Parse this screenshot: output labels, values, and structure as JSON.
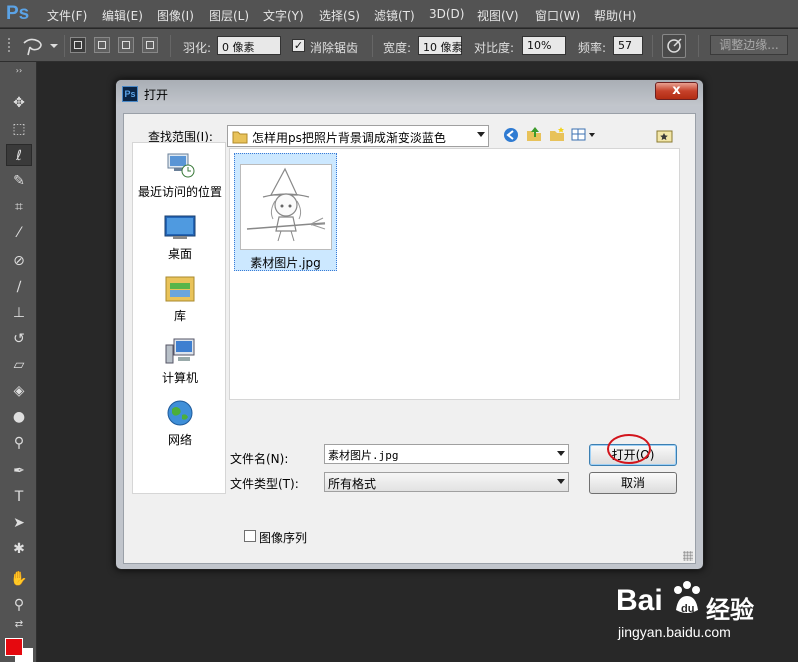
{
  "menubar": {
    "logo": "Ps",
    "items": [
      "文件(F)",
      "编辑(E)",
      "图像(I)",
      "图层(L)",
      "文字(Y)",
      "选择(S)",
      "滤镜(T)",
      "3D(D)",
      "视图(V)",
      "窗口(W)",
      "帮助(H)"
    ]
  },
  "options": {
    "feather_label": "羽化:",
    "feather_value": "0 像素",
    "antialias_label": "消除锯齿",
    "antialias_checked": true,
    "width_label": "宽度:",
    "width_value": "10 像素",
    "contrast_label": "对比度:",
    "contrast_value": "10%",
    "frequency_label": "频率:",
    "frequency_value": "57",
    "refine_label": "调整边缘..."
  },
  "dialog": {
    "title": "打开",
    "close_glyph": "x",
    "look_in_label": "查找范围(I):",
    "look_in_value": "怎样用ps把照片背景调成渐变淡蓝色",
    "places": [
      "最近访问的位置",
      "桌面",
      "库",
      "计算机",
      "网络"
    ],
    "files": [
      {
        "name": "素材图片.jpg"
      }
    ],
    "filename_label": "文件名(N):",
    "filename_value": "素材图片.jpg",
    "filetype_label": "文件类型(T):",
    "filetype_value": "所有格式",
    "open_button": "打开(O)",
    "cancel_button": "取消",
    "image_sequence_label": "图像序列",
    "image_sequence_checked": false
  },
  "colors": {
    "foreground": "#e5090f",
    "background": "#ffffff"
  },
  "watermark": {
    "brand": "Bai",
    "brand_suffix": "经验",
    "url": "jingyan.baidu.com"
  }
}
